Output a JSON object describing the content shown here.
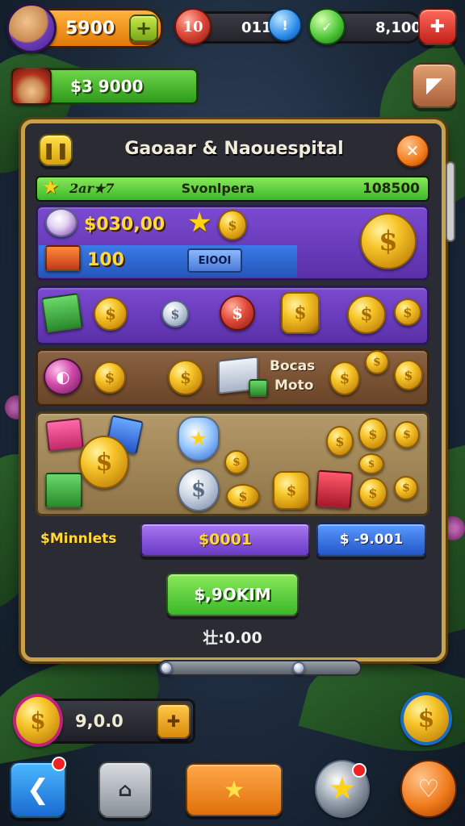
{
  "hud": {
    "level_badge": "",
    "coins_value": "5900",
    "cash_value": "$3 9000",
    "counter_1": "0.1.1",
    "counter_2": "8,100",
    "counter_1_display": "011"
  },
  "panel": {
    "title": "Gaoaar & Naouespital",
    "progress": {
      "left_label": "2ar★7",
      "center_label": "Svonlpera",
      "right_value": "108500",
      "fill_fraction": 1.0
    },
    "row1": {
      "amount": "$030,00",
      "sub_amount": "100",
      "button_label": "EIOOI"
    },
    "row3": {
      "label_line1": "Bocas",
      "label_line2": "Moto"
    },
    "footer": {
      "label": "$Minnlets",
      "purple_value": "$0001",
      "blue_value": "$ -9.001",
      "confirm_label": "$,9OKIM",
      "sub_value": "壮:0.00"
    }
  },
  "bottom_wallet": {
    "value": "9,0.0"
  },
  "colors": {
    "panel_bg": "#2b2b33",
    "panel_border": "#c8a24a",
    "purple": "#6a3ab8",
    "brown": "#7a5230",
    "sand": "#a98a5a",
    "green": "#3eb838",
    "blue": "#2c6fd0",
    "orange": "#f08a1a"
  },
  "icons": {
    "avatar": "pirate-avatar-icon",
    "add": "plus-icon",
    "ticket": "ticket-icon",
    "info": "info-icon",
    "check": "check-icon",
    "gift": "gift-icon",
    "edit": "pencil-icon",
    "close": "close-icon",
    "menu": "pause-icon",
    "back": "back-icon",
    "shop": "shop-icon",
    "star": "star-icon",
    "heart": "heart-icon",
    "coin": "coin-icon"
  }
}
